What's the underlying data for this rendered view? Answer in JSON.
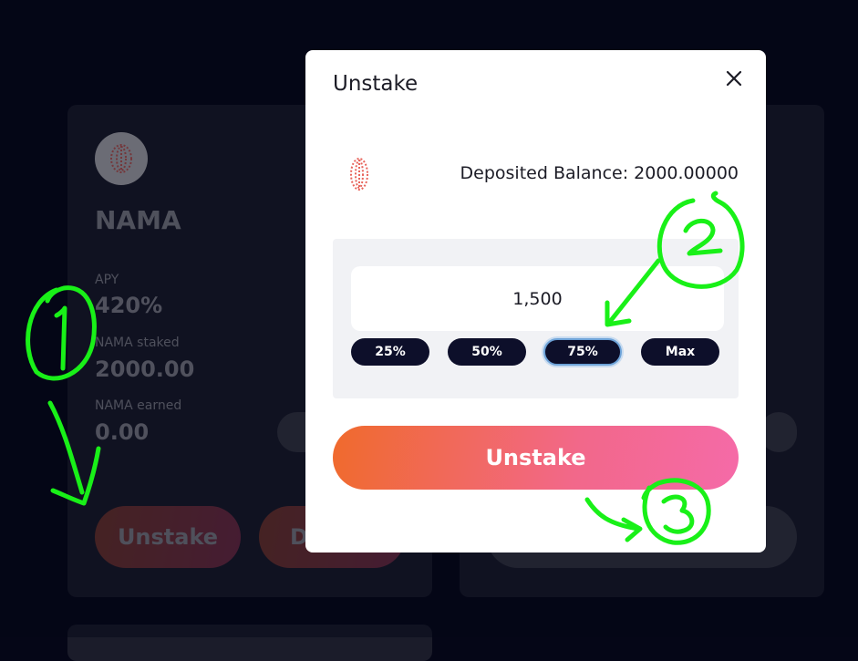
{
  "background_card": {
    "token_name": "NAMA",
    "apy_label": "APY",
    "apy_value": "420%",
    "staked_label": "NAMA staked",
    "staked_value": "2000.00",
    "earned_label": "NAMA earned",
    "earned_value": "0.00",
    "unstake_label": "Unstake",
    "deposit_label_partial": "D"
  },
  "modal": {
    "title": "Unstake",
    "deposited_balance": "Deposited Balance: 2000.00000",
    "amount_value": "1,500",
    "percent_buttons": [
      "25%",
      "50%",
      "75%",
      "Max"
    ],
    "active_percent": "75%",
    "unstake_button": "Unstake"
  },
  "annotations": [
    "1",
    "2",
    "3"
  ],
  "colors": {
    "page_bg": "#050617",
    "card_bg": "#1b1c2a",
    "pill_dark": "#0d0f2a",
    "accent_gradient_start": "#f06a2c",
    "accent_gradient_end": "#f56aa8",
    "annotation_green": "#19f018"
  }
}
